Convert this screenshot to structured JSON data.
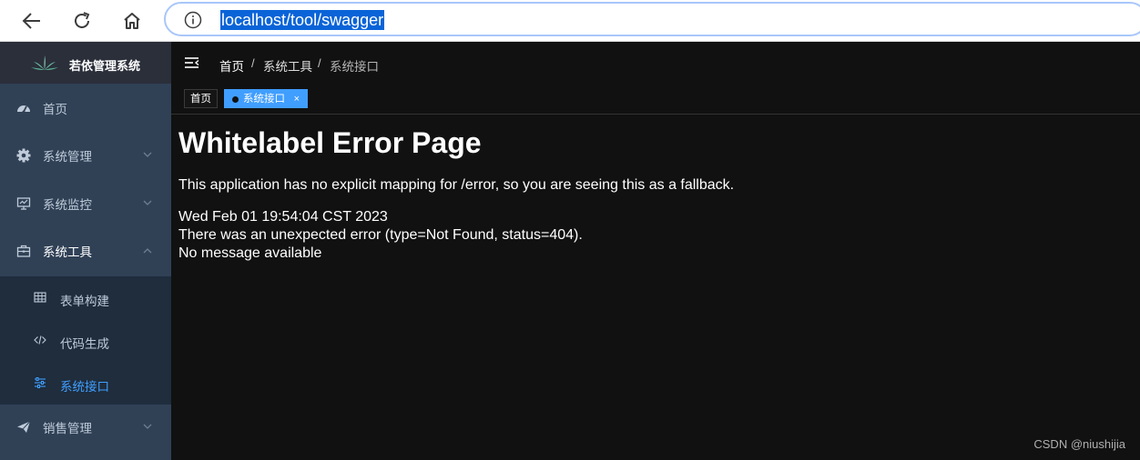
{
  "browser": {
    "url": "localhost/tool/swagger",
    "icons": [
      "back-arrow-icon",
      "reload-icon",
      "home-icon",
      "info-icon"
    ]
  },
  "sidebar": {
    "logo_title": "若依管理系统",
    "items": [
      {
        "label": "首页",
        "icon": "dashboard-icon"
      },
      {
        "label": "系统管理",
        "icon": "gear-icon"
      },
      {
        "label": "系统监控",
        "icon": "monitor-icon"
      },
      {
        "label": "系统工具",
        "icon": "toolbox-icon",
        "expanded": true
      },
      {
        "label": "销售管理",
        "icon": "send-icon"
      }
    ],
    "submenu": [
      {
        "label": "表单构建",
        "icon": "grid-icon"
      },
      {
        "label": "代码生成",
        "icon": "code-icon"
      },
      {
        "label": "系统接口",
        "icon": "sliders-icon",
        "active": true
      }
    ]
  },
  "breadcrumb": {
    "items": [
      "首页",
      "系统工具",
      "系统接口"
    ],
    "separator": "/"
  },
  "tags": {
    "items": [
      {
        "label": "首页"
      },
      {
        "label": "系统接口",
        "active": true,
        "close": "×"
      }
    ]
  },
  "error_page": {
    "title": "Whitelabel Error Page",
    "message": "This application has no explicit mapping for /error, so you are seeing this as a fallback.",
    "timestamp": "Wed Feb 01 19:54:04 CST 2023",
    "error": "There was an unexpected error (type=Not Found, status=404).",
    "detail": "No message available"
  },
  "watermark": "CSDN @niushijia",
  "colors": {
    "sidebar_bg": "#304156",
    "submenu_bg": "#1f2d3d",
    "accent": "#409eff",
    "content_bg": "#111111"
  }
}
